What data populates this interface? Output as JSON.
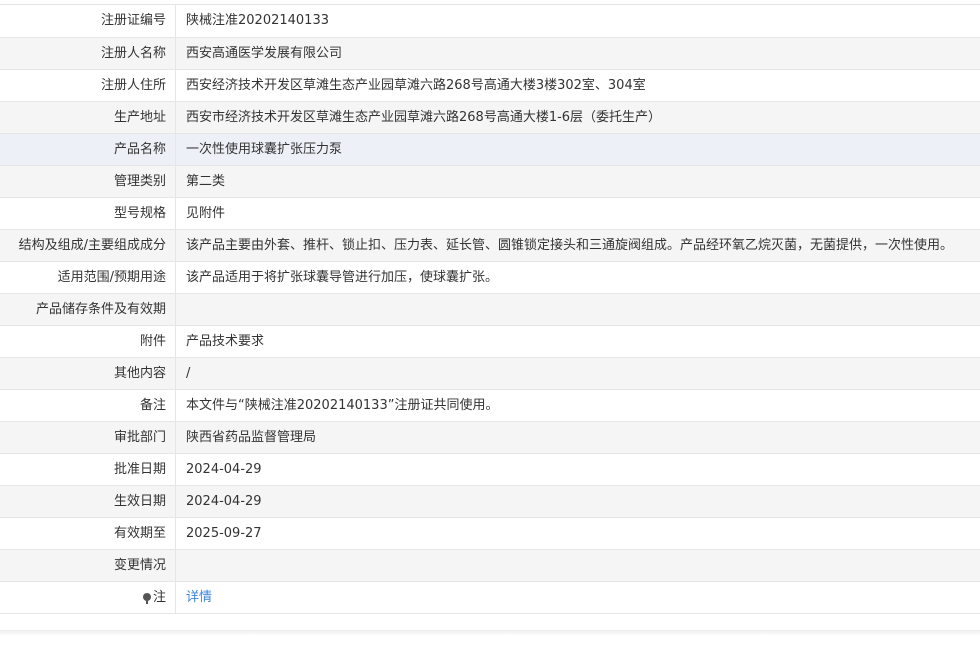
{
  "rows": [
    {
      "label": "注册证编号",
      "value": "陕械注准20202140133"
    },
    {
      "label": "注册人名称",
      "value": "西安高通医学发展有限公司"
    },
    {
      "label": "注册人住所",
      "value": "西安经济技术开发区草滩生态产业园草滩六路268号高通大楼3楼302室、304室"
    },
    {
      "label": "生产地址",
      "value": "西安市经济技术开发区草滩生态产业园草滩六路268号高通大楼1-6层（委托生产）"
    },
    {
      "label": "产品名称",
      "value": "一次性使用球囊扩张压力泵"
    },
    {
      "label": "管理类别",
      "value": "第二类"
    },
    {
      "label": "型号规格",
      "value": "见附件"
    },
    {
      "label": "结构及组成/主要组成成分",
      "value": "该产品主要由外套、推杆、锁止扣、压力表、延长管、圆锥锁定接头和三通旋阀组成。产品经环氧乙烷灭菌，无菌提供，一次性使用。"
    },
    {
      "label": "适用范围/预期用途",
      "value": "该产品适用于将扩张球囊导管进行加压，使球囊扩张。"
    },
    {
      "label": "产品储存条件及有效期",
      "value": ""
    },
    {
      "label": "附件",
      "value": "产品技术要求"
    },
    {
      "label": "其他内容",
      "value": "/"
    },
    {
      "label": "备注",
      "value": "本文件与“陕械注准20202140133”注册证共同使用。"
    },
    {
      "label": "审批部门",
      "value": "陕西省药品监督管理局"
    },
    {
      "label": "批准日期",
      "value": "2024-04-29"
    },
    {
      "label": "生效日期",
      "value": "2024-04-29"
    },
    {
      "label": "有效期至",
      "value": "2025-09-27"
    },
    {
      "label": "变更情况",
      "value": ""
    }
  ],
  "note": {
    "label": "注",
    "link_text": "详情",
    "icon": "pin-icon"
  },
  "colors": {
    "link": "#3c84d8",
    "row_alt": "#f5f5f5",
    "row_highlight": "#edf1f7",
    "border": "#e6e6e6"
  }
}
